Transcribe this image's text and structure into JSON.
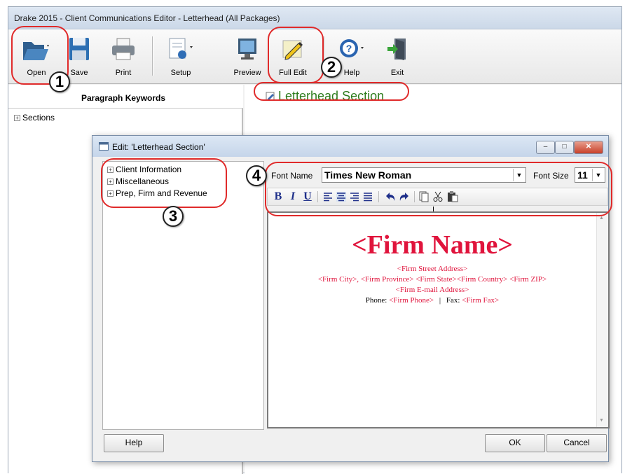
{
  "window": {
    "title": "Drake 2015 - Client Communications Editor - Letterhead (All Packages)"
  },
  "toolbar": {
    "open": "Open",
    "save": "Save",
    "print": "Print",
    "setup": "Setup",
    "preview": "Preview",
    "full_edit": "Full Edit",
    "help": "Help",
    "exit": "Exit"
  },
  "left_pane": {
    "header": "Paragraph Keywords",
    "tree": [
      "Sections"
    ]
  },
  "right_pane": {
    "section_title": "Letterhead Section"
  },
  "dialog": {
    "title": "Edit: 'Letterhead Section'",
    "window_buttons": {
      "minimize": "–",
      "maximize": "□",
      "close": "✕"
    },
    "tree": [
      "Client Information",
      "Miscellaneous",
      "Prep, Firm and Revenue"
    ],
    "font_name_label": "Font Name",
    "font_name_value": "Times New Roman",
    "font_size_label": "Font Size",
    "font_size_value": "11",
    "format_buttons": [
      "B",
      "I",
      "U"
    ],
    "document": {
      "firm_name": "<Firm Name>",
      "street": "<Firm Street Address>",
      "city_line": "<Firm City>, <Firm Province> <Firm State><Firm Country> <Firm ZIP>",
      "email": "<Firm E-mail Address>",
      "phone_label": "Phone:",
      "phone_value": "<Firm Phone>",
      "divider": "|",
      "fax_label": "Fax:",
      "fax_value": "<Firm Fax>"
    },
    "buttons": {
      "help": "Help",
      "ok": "OK",
      "cancel": "Cancel"
    }
  },
  "callouts": [
    "1",
    "2",
    "3",
    "4"
  ],
  "colors": {
    "callout": "#e02a2a",
    "section_title": "#2e7d1e",
    "merge_field": "#e0143c"
  }
}
